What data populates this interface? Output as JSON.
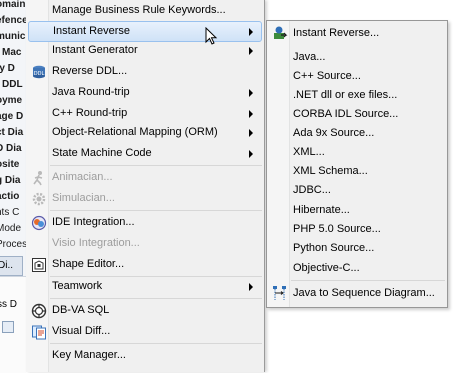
{
  "background_fragments": [
    "omain",
    "efence",
    "munic",
    "Mac",
    "ty D",
    "DDL",
    "oyme",
    "age D",
    "ct Dia",
    "D Dia",
    "osite",
    "g Dia",
    "actio",
    "nts C",
    "Mode",
    "Proces"
  ],
  "background_tab": "Di..",
  "background_lower_text": "ss D",
  "menu": {
    "items": [
      {
        "label": "Manage Business Rule Keywords...",
        "disabled": false,
        "submenu": false,
        "icon": ""
      },
      {
        "label": "Instant Reverse",
        "disabled": false,
        "submenu": true,
        "icon": "",
        "active": true
      },
      {
        "label": "Instant Generator",
        "disabled": false,
        "submenu": true,
        "icon": ""
      },
      {
        "label": "Reverse DDL...",
        "disabled": false,
        "submenu": false,
        "icon": "reverse-ddl-icon"
      },
      {
        "label": "Java Round-trip",
        "disabled": false,
        "submenu": true,
        "icon": ""
      },
      {
        "label": "C++ Round-trip",
        "disabled": false,
        "submenu": true,
        "icon": ""
      },
      {
        "label": "Object-Relational Mapping (ORM)",
        "disabled": false,
        "submenu": true,
        "icon": ""
      },
      {
        "label": "State Machine Code",
        "disabled": false,
        "submenu": true,
        "icon": ""
      },
      {
        "label": "Animacian...",
        "disabled": true,
        "submenu": false,
        "icon": "animacian-icon"
      },
      {
        "label": "Simulacian...",
        "disabled": true,
        "submenu": false,
        "icon": "simulacian-gear-icon"
      },
      {
        "label": "IDE Integration...",
        "disabled": false,
        "submenu": false,
        "icon": "ide-integration-icon"
      },
      {
        "label": "Visio Integration...",
        "disabled": true,
        "submenu": false,
        "icon": ""
      },
      {
        "label": "Shape Editor...",
        "disabled": false,
        "submenu": false,
        "icon": "shape-editor-icon"
      },
      {
        "label": "Teamwork",
        "disabled": false,
        "submenu": true,
        "icon": ""
      },
      {
        "label": "DB-VA SQL",
        "disabled": false,
        "submenu": false,
        "icon": "db-va-sql-icon"
      },
      {
        "label": "Visual Diff...",
        "disabled": false,
        "submenu": false,
        "icon": "visual-diff-icon"
      },
      {
        "label": "Key Manager...",
        "disabled": false,
        "submenu": false,
        "icon": ""
      }
    ]
  },
  "submenu": {
    "items": [
      {
        "label": "Instant Reverse...",
        "icon": "instant-reverse-icon"
      },
      {
        "label": "Java...",
        "icon": ""
      },
      {
        "label": "C++ Source...",
        "icon": ""
      },
      {
        "label": ".NET dll or exe files...",
        "icon": ""
      },
      {
        "label": "CORBA IDL Source...",
        "icon": ""
      },
      {
        "label": "Ada 9x Source...",
        "icon": ""
      },
      {
        "label": "XML...",
        "icon": ""
      },
      {
        "label": "XML Schema...",
        "icon": ""
      },
      {
        "label": "JDBC...",
        "icon": ""
      },
      {
        "label": "Hibernate...",
        "icon": ""
      },
      {
        "label": "PHP 5.0 Source...",
        "icon": ""
      },
      {
        "label": "Python Source...",
        "icon": ""
      },
      {
        "label": "Objective-C...",
        "icon": ""
      },
      {
        "label": "Java to Sequence Diagram...",
        "icon": "sequence-diagram-icon"
      }
    ]
  },
  "colors": {
    "menu_bg": "#f0f0f0",
    "highlight_border": "#99c1ee",
    "disabled_text": "#9d9d9d"
  }
}
